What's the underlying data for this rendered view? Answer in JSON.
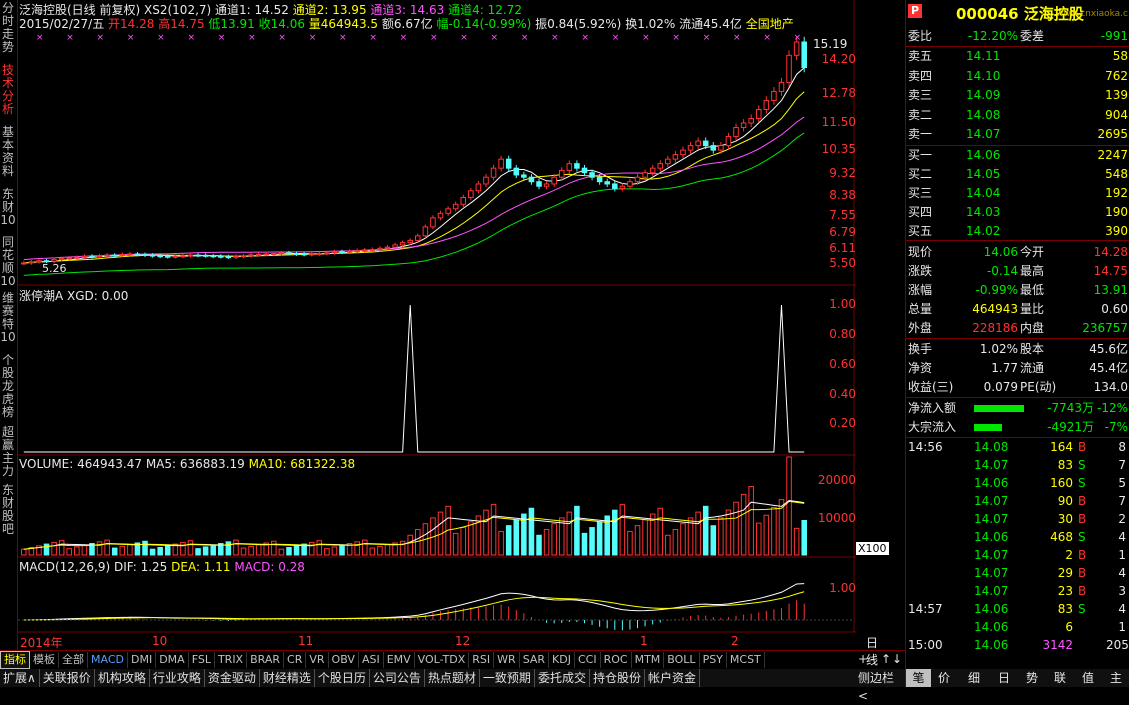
{
  "colors": {
    "up": "#ff3232",
    "down": "#54fcfc",
    "bg": "#000000",
    "axis": "#7a0000"
  },
  "side_tabs": [
    "分时走势",
    "技术分析",
    "基本资料",
    "东财10",
    "同花顺10",
    "维赛特10",
    "个股龙虎榜",
    "超赢主力",
    "东财股吧"
  ],
  "header": {
    "line1_name": "泛海控股(日线 前复权)",
    "line1_xs2": "XS2(102,7)",
    "ch1": "通道1: 14.52",
    "ch2": "通道2: 13.95",
    "ch3": "通道3: 14.63",
    "ch4": "通道4: 12.72",
    "line2_date": "2015/02/27/五",
    "open": "开14.28",
    "high": "高14.75",
    "low": "低13.91",
    "close": "收14.06",
    "vol": "量464943.5",
    "amt": "额6.67亿",
    "chg": "幅-0.14(-0.99%)",
    "amp": "振0.84(5.92%)",
    "turn": "换1.02%",
    "float": "流通45.4亿",
    "sector": "全国地产"
  },
  "price_axis": [
    "14.20",
    "12.78",
    "11.50",
    "10.35",
    "9.32",
    "8.38",
    "7.55",
    "6.79",
    "6.11",
    "5.50"
  ],
  "price_marks": {
    "high_label": "15.19",
    "low_label": "5.26"
  },
  "ind1": {
    "label": "涨停潮A  XGD: 0.00",
    "axis": [
      "1.00",
      "0.80",
      "0.60",
      "0.40",
      "0.20"
    ]
  },
  "volume": {
    "label_v": "VOLUME: 464943.47",
    "label_ma5": "MA5: 636883.19",
    "label_ma10": "MA10: 681322.38",
    "axis": [
      "20000",
      "10000"
    ],
    "unit": "X100"
  },
  "macd": {
    "label": "MACD(12,26,9)",
    "dif": "DIF: 1.25",
    "dea": "DEA: 1.11",
    "macd": "MACD: 0.28",
    "axis": [
      "1.00"
    ]
  },
  "date_axis": [
    "2014年",
    "10",
    "11",
    "12",
    "1",
    "2"
  ],
  "date_axis_right": "日线",
  "zoom_buttons": [
    "+",
    "-",
    "↑",
    "↓"
  ],
  "bottom_tabs": [
    "指标",
    "模板",
    "全部",
    "MACD",
    "DMI",
    "DMA",
    "FSL",
    "TRIX",
    "BRAR",
    "CR",
    "VR",
    "OBV",
    "ASI",
    "EMV",
    "VOL-TDX",
    "RSI",
    "WR",
    "SAR",
    "KDJ",
    "CCI",
    "ROC",
    "MTM",
    "BOLL",
    "PSY",
    "MCST"
  ],
  "nav_tabs": [
    "扩展∧",
    "关联报价",
    "机构攻略",
    "行业攻略",
    "资金驱动",
    "财经精选",
    "个股日历",
    "公司公告",
    "热点题材",
    "一致预期",
    "委托成交",
    "持仓股份",
    "帐户资金"
  ],
  "nav_right": [
    "侧边栏<",
    "笔",
    "价",
    "细",
    "日",
    "势",
    "联",
    "值",
    "主"
  ],
  "quote": {
    "code": "000046",
    "name": "泛海控股",
    "logo_text": "www.cnxiaoka.com",
    "weibi_label": "委比",
    "weibi": "-12.20%",
    "weicha_label": "委差",
    "weicha": "-991",
    "asks": [
      [
        "卖五",
        "14.11",
        "58"
      ],
      [
        "卖四",
        "14.10",
        "762"
      ],
      [
        "卖三",
        "14.09",
        "139"
      ],
      [
        "卖二",
        "14.08",
        "904"
      ],
      [
        "卖一",
        "14.07",
        "2695"
      ]
    ],
    "bids": [
      [
        "买一",
        "14.06",
        "2247"
      ],
      [
        "买二",
        "14.05",
        "548"
      ],
      [
        "买三",
        "14.04",
        "192"
      ],
      [
        "买四",
        "14.03",
        "190"
      ],
      [
        "买五",
        "14.02",
        "390"
      ]
    ],
    "stats": [
      [
        "现价",
        "14.06",
        "今开",
        "14.28"
      ],
      [
        "涨跌",
        "-0.14",
        "最高",
        "14.75"
      ],
      [
        "涨幅",
        "-0.99%",
        "最低",
        "13.91"
      ],
      [
        "总量",
        "464943",
        "量比",
        "0.60"
      ],
      [
        "外盘",
        "228186",
        "内盘",
        "236757"
      ]
    ],
    "fund": [
      [
        "换手",
        "1.02%",
        "股本",
        "45.6亿"
      ],
      [
        "净资",
        "1.77",
        "流通",
        "45.4亿"
      ],
      [
        "收益(三)",
        "0.079",
        "PE(动)",
        "134.0"
      ]
    ],
    "flow": [
      [
        "净流入额",
        "-7743万",
        "-12%"
      ],
      [
        "大宗流入",
        "-4921万",
        "-7%"
      ]
    ],
    "ticks": [
      [
        "14:56",
        "14.08",
        "164",
        "B",
        "8"
      ],
      [
        "",
        "14.07",
        "83",
        "S",
        "7"
      ],
      [
        "",
        "14.06",
        "160",
        "S",
        "5"
      ],
      [
        "",
        "14.07",
        "90",
        "B",
        "7"
      ],
      [
        "",
        "14.07",
        "30",
        "B",
        "2"
      ],
      [
        "",
        "14.06",
        "468",
        "S",
        "4"
      ],
      [
        "",
        "14.07",
        "2",
        "B",
        "1"
      ],
      [
        "",
        "14.07",
        "29",
        "B",
        "4"
      ],
      [
        "",
        "14.07",
        "23",
        "B",
        "3"
      ],
      [
        "14:57",
        "14.06",
        "83",
        "S",
        "4"
      ],
      [
        "",
        "14.06",
        "6",
        "",
        "1"
      ],
      [
        "15:00",
        "14.06",
        "3142",
        "",
        "205"
      ]
    ]
  },
  "chart_data": {
    "type": "candlestick",
    "title": "泛海控股(日线 前复权)",
    "ylim": [
      5.0,
      15.5
    ],
    "closes": [
      5.4,
      5.45,
      5.5,
      5.48,
      5.55,
      5.6,
      5.62,
      5.65,
      5.7,
      5.68,
      5.72,
      5.75,
      5.74,
      5.78,
      5.8,
      5.78,
      5.75,
      5.72,
      5.7,
      5.68,
      5.7,
      5.72,
      5.75,
      5.74,
      5.72,
      5.7,
      5.68,
      5.66,
      5.7,
      5.72,
      5.76,
      5.78,
      5.8,
      5.82,
      5.85,
      5.82,
      5.8,
      5.78,
      5.8,
      5.82,
      5.85,
      5.9,
      5.88,
      5.92,
      5.95,
      5.98,
      6.0,
      6.05,
      6.1,
      6.2,
      6.3,
      6.4,
      6.6,
      7.0,
      7.4,
      7.6,
      7.8,
      8.0,
      8.3,
      8.6,
      8.9,
      9.2,
      9.6,
      10.0,
      9.6,
      9.3,
      9.2,
      9.0,
      8.8,
      8.9,
      9.2,
      9.5,
      9.8,
      9.6,
      9.4,
      9.2,
      9.0,
      8.9,
      8.7,
      8.8,
      9.0,
      9.2,
      9.4,
      9.6,
      9.8,
      10.0,
      10.2,
      10.4,
      10.6,
      10.8,
      10.6,
      10.4,
      10.6,
      11.0,
      11.4,
      11.6,
      11.8,
      12.2,
      12.6,
      13.0,
      13.4,
      14.6,
      15.19,
      14.06
    ]
  }
}
